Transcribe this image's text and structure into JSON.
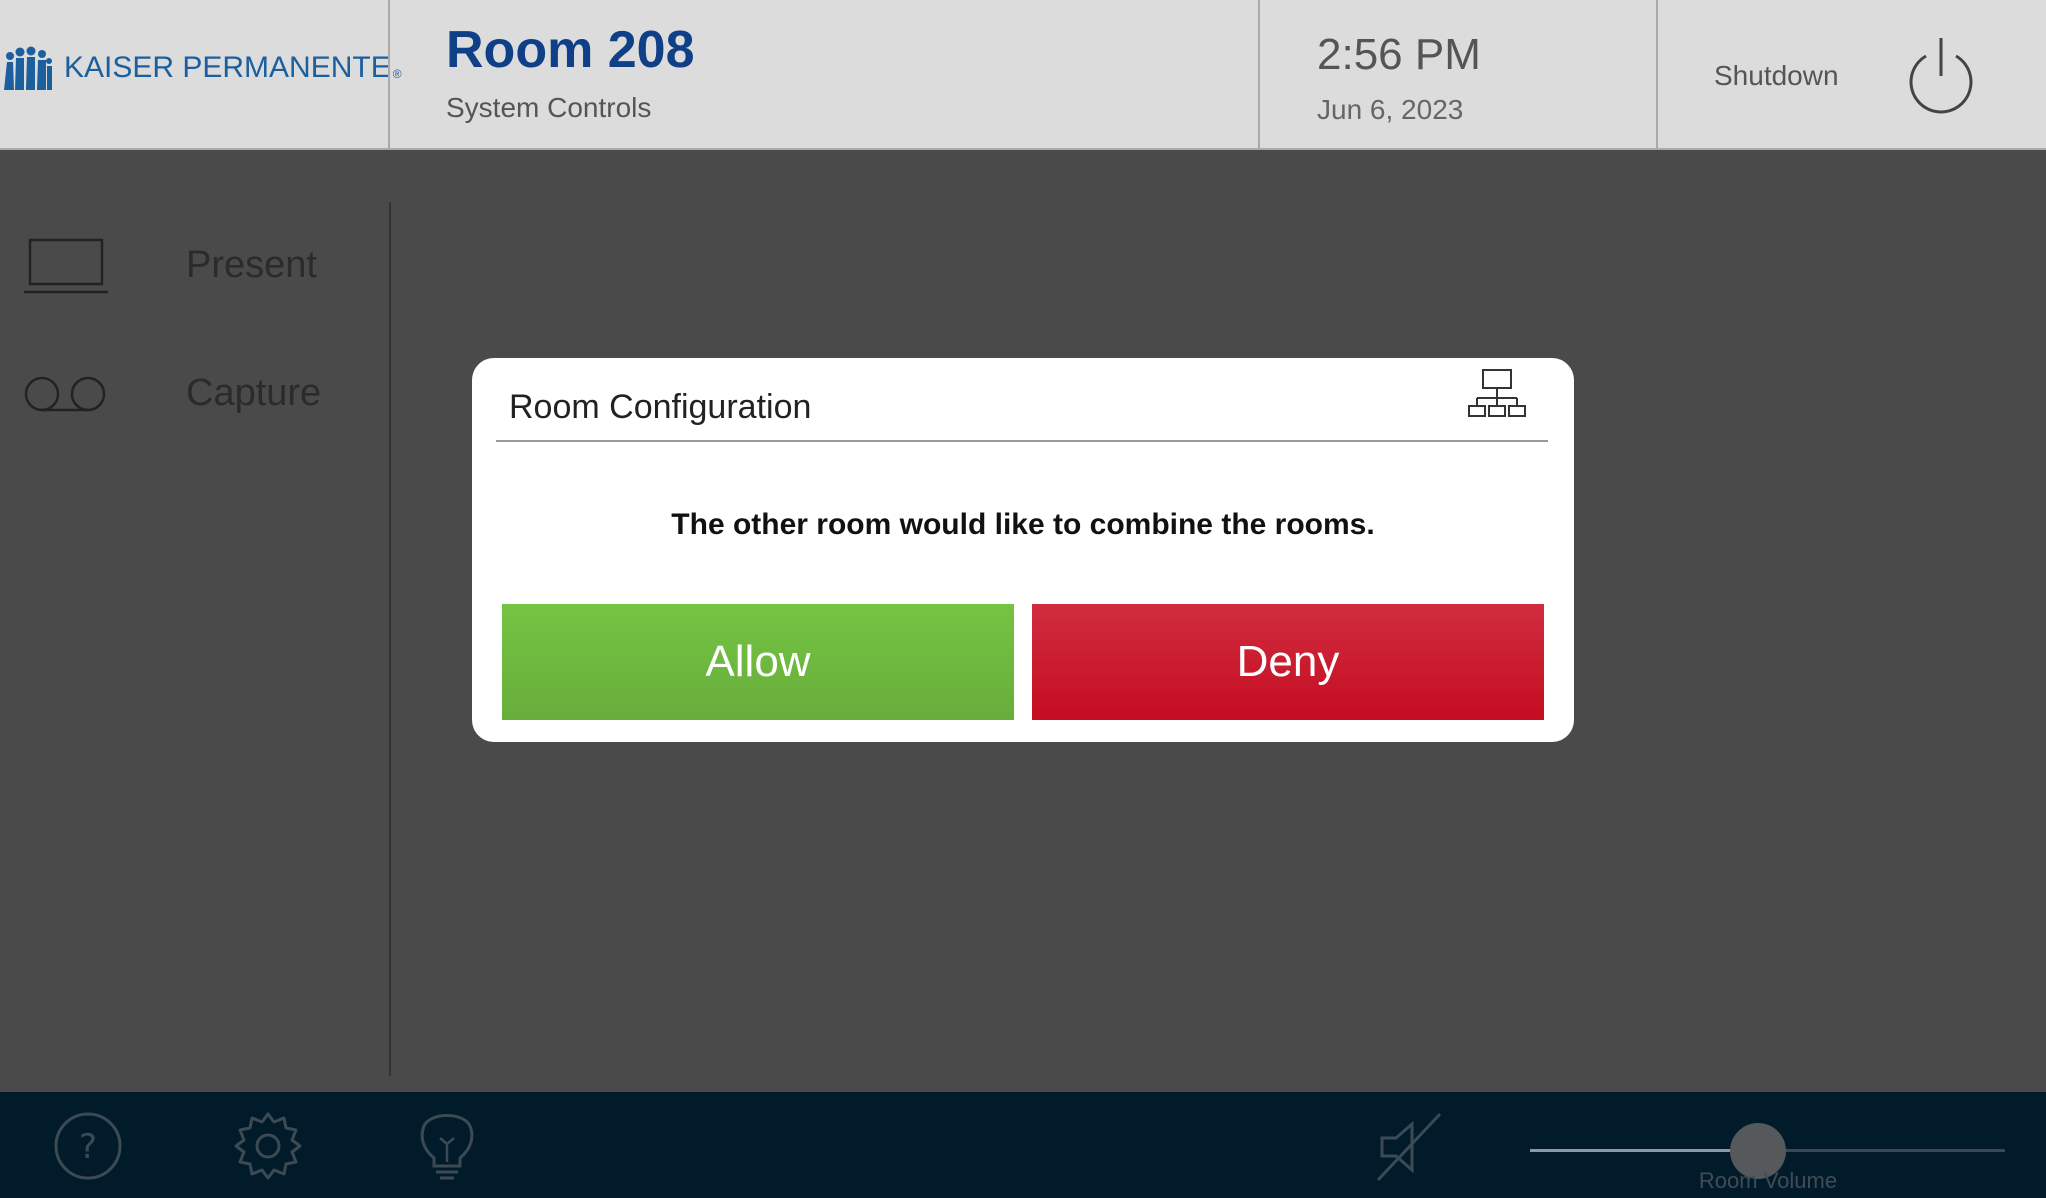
{
  "header": {
    "brand": "KAISER PERMANENTE",
    "brand_mark": "®",
    "room_title": "Room 208",
    "room_subtitle": "System Controls",
    "time": "2:56 PM",
    "date": "Jun 6, 2023",
    "shutdown_label": "Shutdown"
  },
  "sidebar": {
    "items": [
      {
        "label": "Present",
        "icon": "laptop-icon"
      },
      {
        "label": "Capture",
        "icon": "record-icon"
      }
    ]
  },
  "dialog": {
    "title": "Room Configuration",
    "message": "The other room would like to combine the rooms.",
    "allow_label": "Allow",
    "deny_label": "Deny",
    "icon": "network-icon"
  },
  "footer": {
    "icons": [
      "help-icon",
      "gear-icon",
      "lightbulb-icon",
      "speaker-muted-icon"
    ],
    "volume_label": "Room Volume",
    "volume_level": 0.5
  },
  "colors": {
    "allow": "#6dbb3f",
    "deny": "#c91a2e",
    "footer": "#011b2a",
    "brand": "#1b5f9f"
  }
}
